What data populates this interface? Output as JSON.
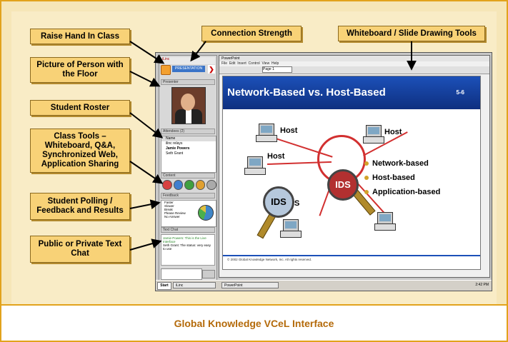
{
  "callouts": {
    "raise_hand": "Raise Hand In Class",
    "connection": "Connection Strength",
    "whiteboard_tools": "Whiteboard / Slide Drawing Tools",
    "picture": "Picture of Person with the Floor",
    "roster": "Student Roster",
    "class_tools": "Class Tools – Whiteboard, Q&A, Synchronized Web, Application Sharing",
    "polling": "Student Polling / Feedback and Results",
    "chat": "Public or Private Text Chat"
  },
  "caption": "Global Knowledge VCeL Interface",
  "app": {
    "top_label": "iLinc",
    "presentation_btn": "PRESENTATION",
    "presenter_hdr": "Presenter",
    "attendees_hdr": "Attendees (2)",
    "roster_header": "Name",
    "roster": [
      "ilinc relays",
      "Jamie Powers",
      "Seth Grant"
    ],
    "content_hdr": "Content",
    "feedback_hdr": "Feedback",
    "poll_rows": [
      "Faster",
      "Slower",
      "Break",
      "Please Review",
      "No Answer"
    ],
    "chat_hdr": "Text Chat",
    "chat_msgs": [
      "Jamie Powers: This is the Live Interface",
      "Seth Grant: The status: very easy to use"
    ],
    "ppt_title": "PowerPoint",
    "ppt_menu": [
      "File",
      "Edit",
      "Insert",
      "Control",
      "View",
      "Help"
    ],
    "page_select": "Page 1",
    "slide": {
      "title": "Network-Based vs. Host-Based",
      "number": "5-6",
      "hosts": [
        "Host",
        "Host",
        "Host"
      ],
      "bullets": [
        "Network-based",
        "Host-based",
        "Application-based"
      ],
      "ids_labels": [
        "IDS",
        "IDS"
      ],
      "s_label": "S",
      "footer": "© 2002 Global Knowledge Network, Inc. All rights reserved."
    },
    "taskbar": {
      "start": "Start",
      "items": [
        "iLinc",
        "PowerPoint"
      ],
      "clock": "2:42 PM"
    }
  },
  "colors": {
    "border": "#e2a31c",
    "background": "#f6e6b8",
    "callout": "#f8d277",
    "caption_text": "#b46a0a",
    "slide_header": "#1c50b8"
  }
}
